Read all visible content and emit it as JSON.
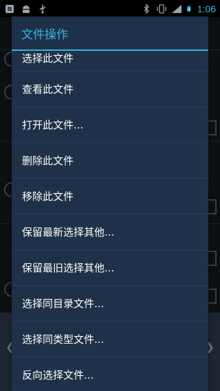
{
  "status_bar": {
    "time": "1:06",
    "left_icons": [
      "app-notification-icon",
      "android-icon",
      "usb-icon"
    ],
    "right_icons": [
      "bluetooth-icon",
      "vibrate-icon",
      "signal-icon",
      "battery-icon"
    ]
  },
  "dialog": {
    "title": "文件操作",
    "items": [
      {
        "label": "选择此文件"
      },
      {
        "label": "查看此文件"
      },
      {
        "label": "打开此文件..."
      },
      {
        "label": "删除此文件"
      },
      {
        "label": "移除此文件"
      },
      {
        "label": "保留最新选择其他..."
      },
      {
        "label": "保留最旧选择其他..."
      },
      {
        "label": "选择同目录文件..."
      },
      {
        "label": "选择同类型文件..."
      },
      {
        "label": "反向选择文件..."
      }
    ]
  },
  "colors": {
    "accent": "#33b5e5",
    "dialog_bg": "#1f3148",
    "divider": "#2c3f56"
  }
}
